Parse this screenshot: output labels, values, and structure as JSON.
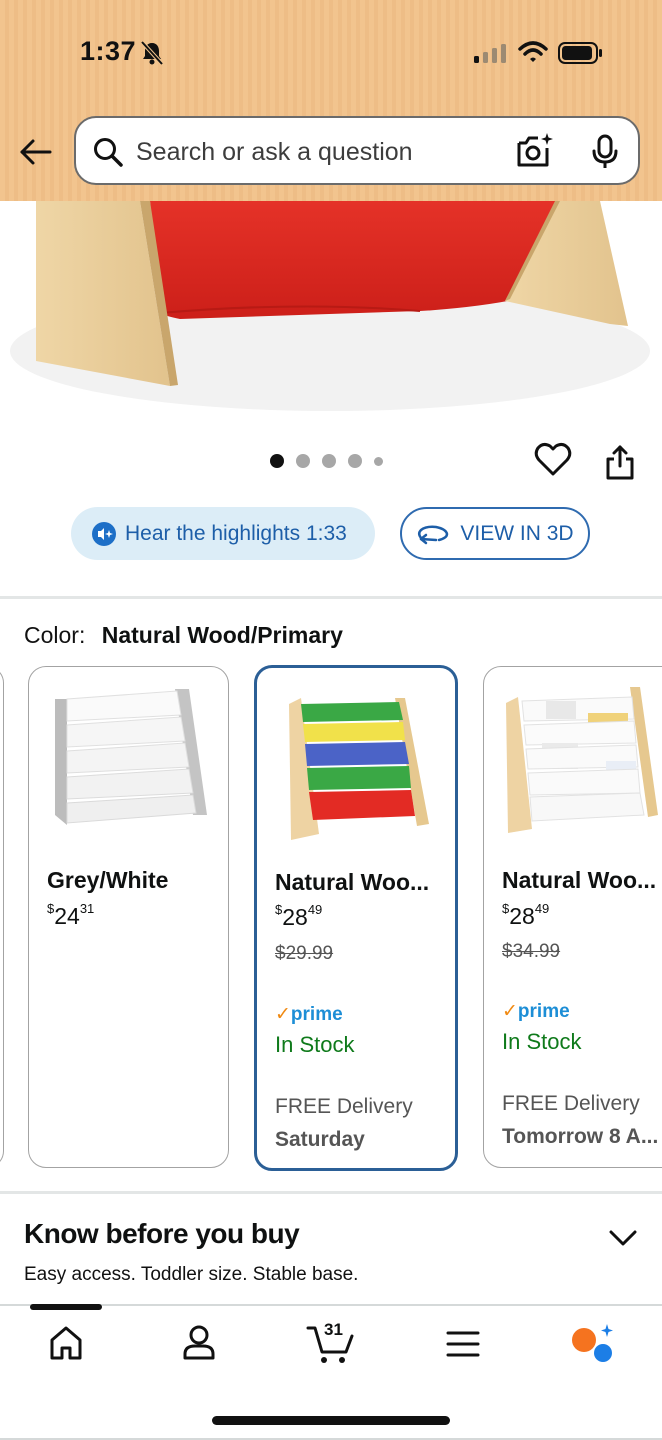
{
  "status_bar": {
    "time": "1:37"
  },
  "search": {
    "placeholder": "Search or ask a question"
  },
  "gallery": {
    "image_count": 5,
    "active_index": 0
  },
  "actions": {
    "hear_highlights": "Hear the highlights 1:33",
    "view_in_3d": "VIEW IN 3D"
  },
  "color": {
    "label": "Color:",
    "selected": "Natural Wood/Primary",
    "options": [
      {
        "name": "Grey/White",
        "price_whole": "24",
        "price_fraction": "31",
        "currency": "$"
      },
      {
        "name": "Natural Woo...",
        "price_whole": "28",
        "price_fraction": "49",
        "currency": "$",
        "list_price": "$29.99",
        "prime": "prime",
        "stock": "In Stock",
        "delivery": "FREE Delivery",
        "delivery_day": "Saturday",
        "selected": true
      },
      {
        "name": "Natural Woo...",
        "price_whole": "28",
        "price_fraction": "49",
        "currency": "$",
        "list_price": "$34.99",
        "prime": "prime",
        "stock": "In Stock",
        "delivery": "FREE Delivery",
        "delivery_day": "Tomorrow 8 A..."
      }
    ]
  },
  "know_before": {
    "title": "Know before you buy",
    "subtitle": "Easy access. Toddler size. Stable base."
  },
  "bottom_nav": {
    "items": [
      "home-icon",
      "account-icon",
      "cart-icon",
      "menu-icon",
      "rufus-icon"
    ],
    "cart_count": "31"
  },
  "colors": {
    "header_bg": "#f2c48e",
    "prime_blue": "#1d8ed6",
    "stock_green": "#0f7a1b",
    "selected_border": "#2b5f96",
    "pill_blue": "#1d5ea8"
  }
}
